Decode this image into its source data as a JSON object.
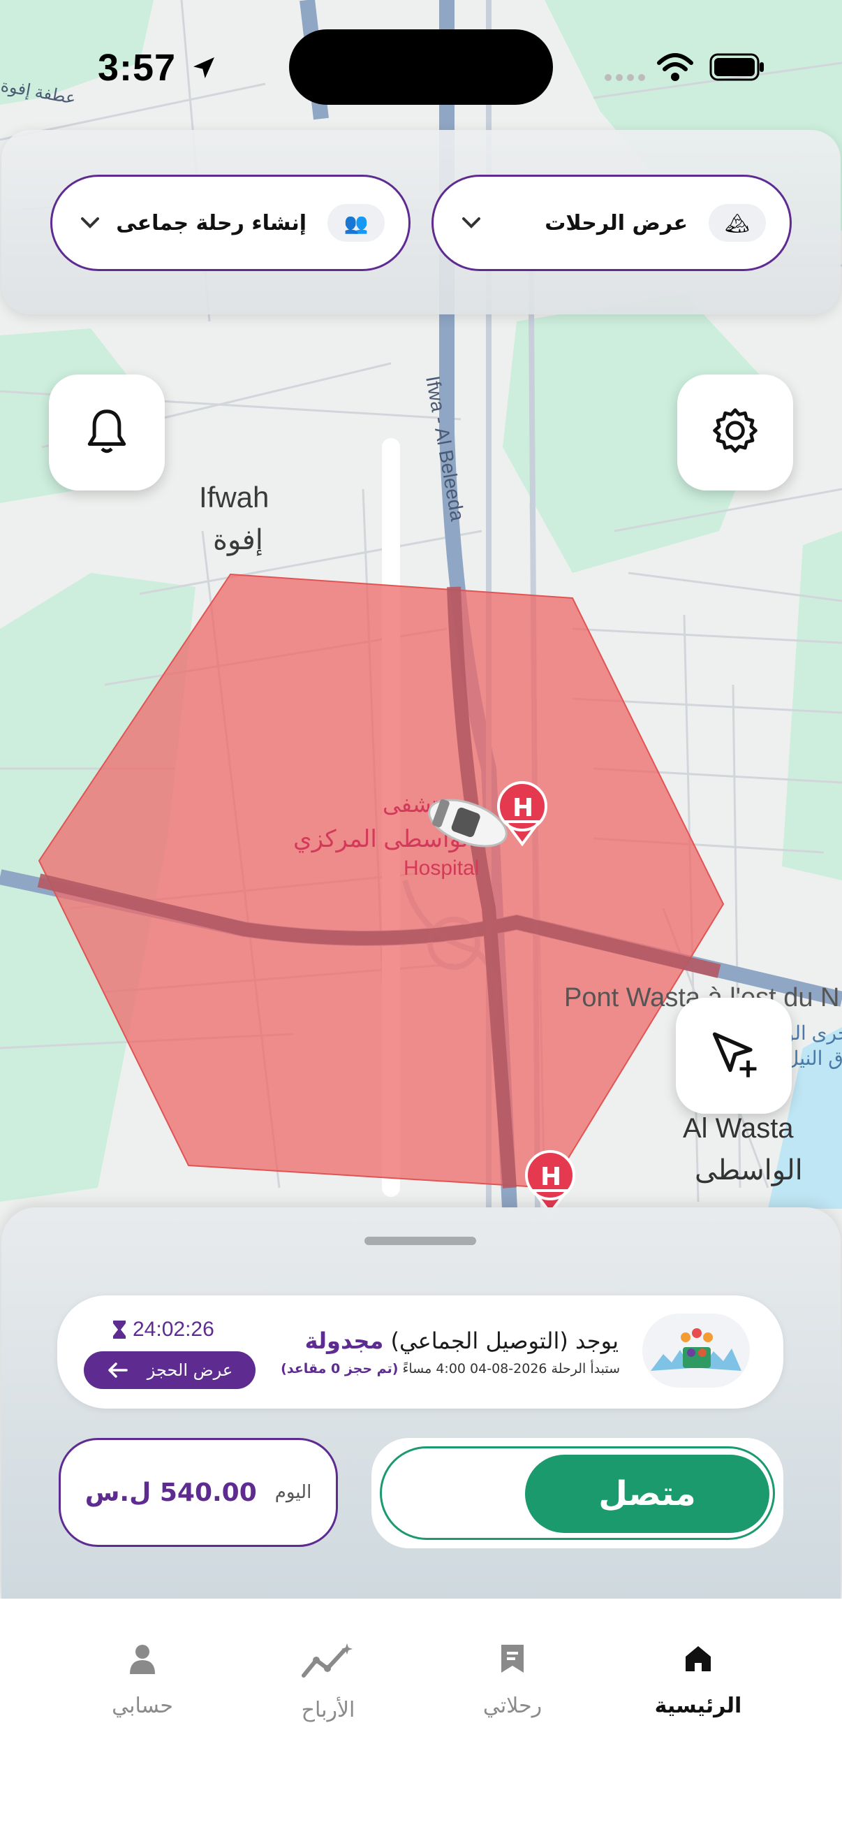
{
  "status_bar": {
    "time": "3:57"
  },
  "top_bar": {
    "show_trips_label": "عرض الرحلات",
    "create_group_trip_label": "إنشاء رحلة جماعى"
  },
  "map": {
    "labels": {
      "ifwah_en": "Ifwah",
      "ifwah_ar": "إفوة",
      "hospital_ar_1": "مستشفى",
      "hospital_ar_2": "الواسطى المركزي",
      "hospital_en": "Hospital",
      "pont": "Pont Wasta à l'est du N",
      "al_wasta_en": "Al Wasta",
      "al_wasta_ar": "الواسطى",
      "road": "Ifwa - Al Beleeda",
      "corner_road": "عطفة إفوة",
      "river_1": "مجرى الو",
      "river_2": "شرق النيل"
    },
    "zone_color": "#ee6a6a"
  },
  "trip_card": {
    "title_prefix": "يوجد (التوصيل الجماعي)",
    "title_status": "مجدولة",
    "subtitle": "ستبدأ الرحلة 2026-08-04 4:00 مساءً",
    "seats": "(تم حجز 0 مقاعد)",
    "timer": "24:02:26",
    "view_booking_label": "عرض الحجز"
  },
  "earnings": {
    "day_label": "اليوم",
    "amount": "540.00 ل.س"
  },
  "online_toggle": {
    "label": "متصل",
    "state": "on",
    "color": "#1b9a6e"
  },
  "tabs": [
    {
      "label": "الرئيسية",
      "icon": "home-icon",
      "active": true
    },
    {
      "label": "رحلاتي",
      "icon": "bookmark-icon",
      "active": false
    },
    {
      "label": "الأرباح",
      "icon": "earnings-chart-icon",
      "active": false
    },
    {
      "label": "حسابي",
      "icon": "person-icon",
      "active": false
    }
  ],
  "colors": {
    "brand": "#5e2c91",
    "online": "#1b9a6e"
  }
}
